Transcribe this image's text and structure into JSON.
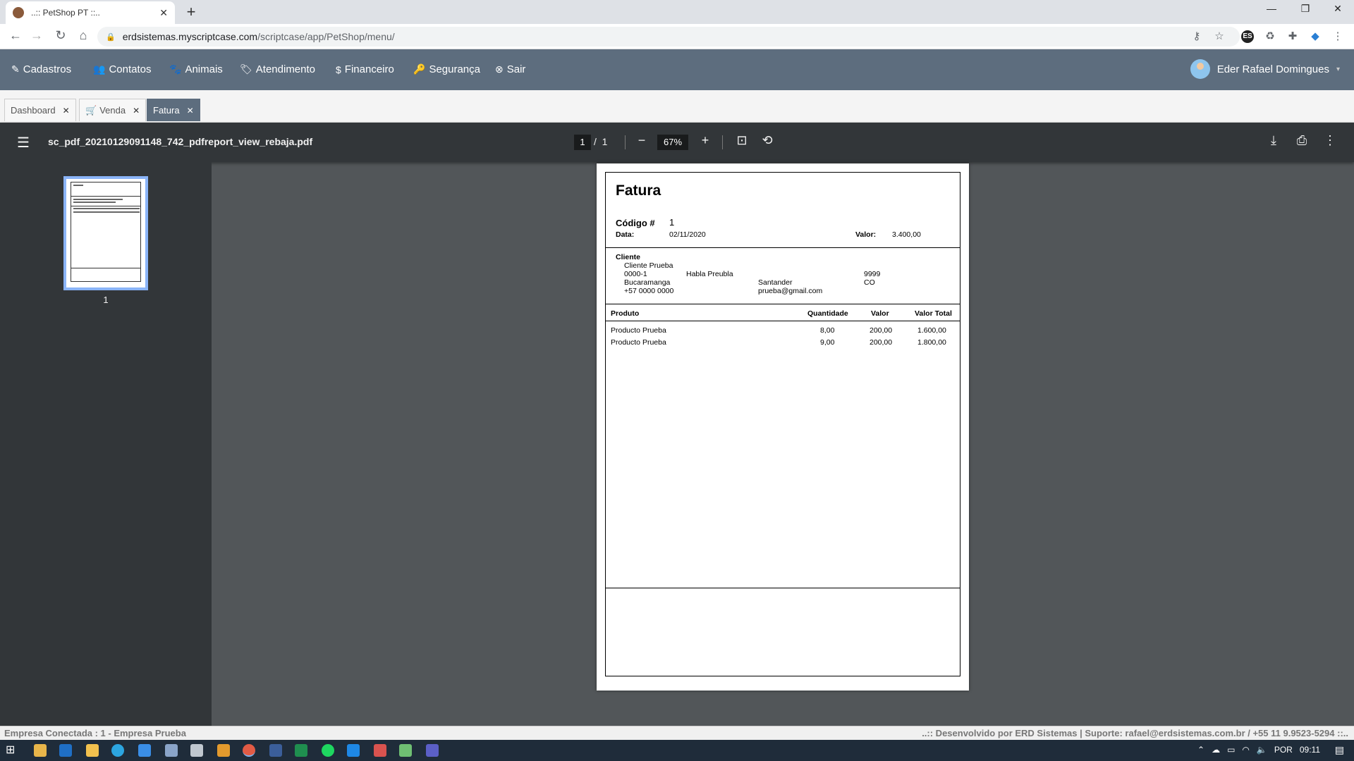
{
  "browser": {
    "tab_title": "..:: PetShop PT ::..",
    "tab_close": "✕",
    "new_tab": "+",
    "minimize": "—",
    "restore": "❐",
    "close": "✕",
    "url_host": "erdsistemas.myscriptcase.com",
    "url_path": "/scriptcase/app/PetShop/menu/",
    "ext_es": "ES"
  },
  "menu": {
    "items": [
      {
        "label": "Cadastros",
        "icon": "✎"
      },
      {
        "label": "Contatos",
        "icon": "👥"
      },
      {
        "label": "Animais",
        "icon": "🐾"
      },
      {
        "label": "Atendimento",
        "icon": "🏷"
      },
      {
        "label": "Financeiro",
        "icon": "$"
      },
      {
        "label": "Segurança",
        "icon": "🔑"
      },
      {
        "label": "Sair",
        "icon": "⊗"
      }
    ],
    "user_name": "Eder Rafael Domingues",
    "user_caret": "▾"
  },
  "app_tabs": [
    {
      "label": "Dashboard",
      "close": "✕"
    },
    {
      "label": "Venda",
      "close": "✕",
      "icon": "🛒"
    },
    {
      "label": "Fatura",
      "close": "✕"
    }
  ],
  "pdf": {
    "filename": "sc_pdf_20210129091148_742_pdfreport_view_rebaja.pdf",
    "current_page": "1",
    "page_sep": "/",
    "total_pages": "1",
    "zoom": "67%",
    "thumb_label": "1"
  },
  "invoice": {
    "title": "Fatura",
    "code_label": "Código #",
    "code": "1",
    "date_label": "Data:",
    "date": "02/11/2020",
    "value_label": "Valor:",
    "value": "3.400,00",
    "client_label": "Cliente",
    "client_name": "Cliente Prueba",
    "client_doc": "0000-1",
    "client_address": "Habla Preubla",
    "client_number": "9999",
    "client_city": "Bucaramanga",
    "client_state": "Santander",
    "client_country": "CO",
    "client_phone": "+57 0000 0000",
    "client_email": "prueba@gmail.com",
    "columns": [
      "Produto",
      "Quantidade",
      "Valor",
      "Valor Total"
    ],
    "rows": [
      {
        "produto": "Producto Prueba",
        "quantidade": "8,00",
        "valor": "200,00",
        "total": "1.600,00"
      },
      {
        "produto": "Producto Prueba",
        "quantidade": "9,00",
        "valor": "200,00",
        "total": "1.800,00"
      }
    ]
  },
  "status": {
    "left": "Empresa Conectada : 1 - Empresa Prueba",
    "right": "..:: Desenvolvido por ERD Sistemas | Suporte: rafael@erdsistemas.com.br / +55 11 9.9523-5294 ::.."
  },
  "taskbar": {
    "lang": "POR",
    "time": "09:11"
  },
  "colors": {
    "menu_bg": "#5d6d7e",
    "pdf_toolbar": "#323639",
    "pdf_bg": "#525659",
    "thumb_border": "#8ab4f8"
  }
}
